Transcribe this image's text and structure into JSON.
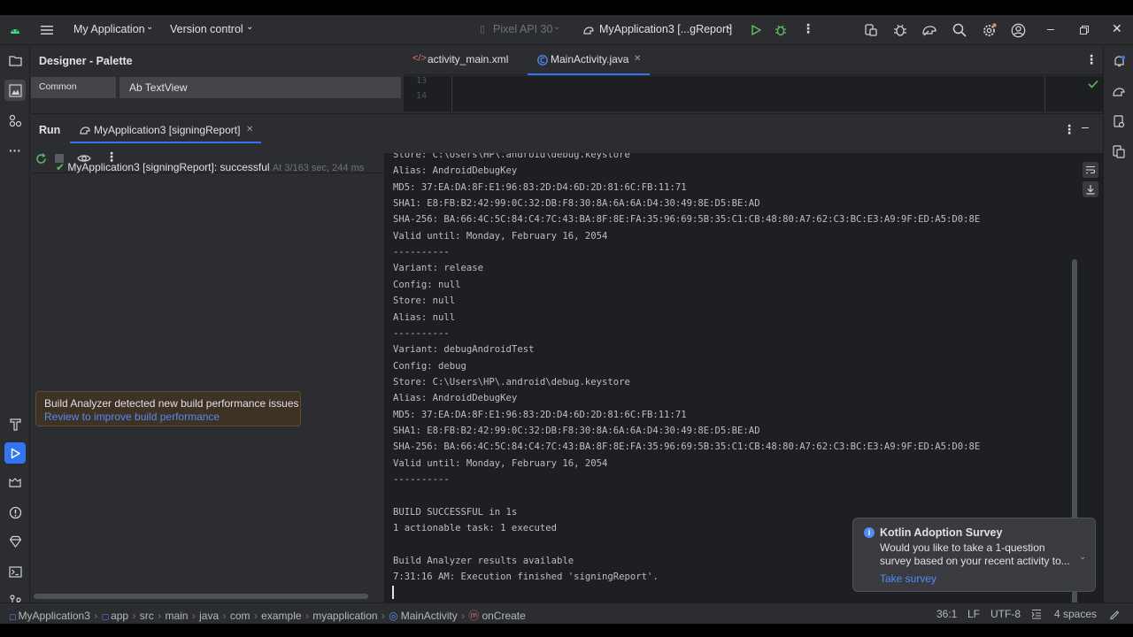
{
  "titlebar": {
    "project": "My Application",
    "vcs": "Version control",
    "device": "Pixel API 30",
    "run_config": "MyApplication3 [...gReport]"
  },
  "designer": {
    "title": "Designer - Palette",
    "category": "Common",
    "item": "Ab TextView"
  },
  "editor": {
    "tabs": [
      {
        "label": "activity_main.xml"
      },
      {
        "label": "MainActivity.java"
      }
    ],
    "line_numbers": [
      "13",
      "14"
    ]
  },
  "run": {
    "title": "Run",
    "tab_label": "MyApplication3 [signingReport]",
    "tree_item": {
      "name": "MyApplication3 [signingReport]:",
      "status": "successful",
      "time": "At 3/16",
      "duration": "3 sec, 244 ms"
    }
  },
  "console": {
    "lines": [
      "Store: C:\\Users\\HP\\.android\\debug.keystore",
      "Alias: AndroidDebugKey",
      "MD5: 37:EA:DA:8F:E1:96:83:2D:D4:6D:2D:81:6C:FB:11:71",
      "SHA1: E8:FB:B2:42:99:0C:32:DB:F8:30:8A:6A:6A:D4:30:49:8E:D5:BE:AD",
      "SHA-256: BA:66:4C:5C:84:C4:7C:43:BA:8F:8E:FA:35:96:69:5B:35:C1:CB:48:80:A7:62:C3:BC:E3:A9:9F:ED:A5:D0:8E",
      "Valid until: Monday, February 16, 2054",
      "----------",
      "Variant: release",
      "Config: null",
      "Store: null",
      "Alias: null",
      "----------",
      "Variant: debugAndroidTest",
      "Config: debug",
      "Store: C:\\Users\\HP\\.android\\debug.keystore",
      "Alias: AndroidDebugKey",
      "MD5: 37:EA:DA:8F:E1:96:83:2D:D4:6D:2D:81:6C:FB:11:71",
      "SHA1: E8:FB:B2:42:99:0C:32:DB:F8:30:8A:6A:6A:D4:30:49:8E:D5:BE:AD",
      "SHA-256: BA:66:4C:5C:84:C4:7C:43:BA:8F:8E:FA:35:96:69:5B:35:C1:CB:48:80:A7:62:C3:BC:E3:A9:9F:ED:A5:D0:8E",
      "Valid until: Monday, February 16, 2054",
      "----------",
      "",
      "BUILD SUCCESSFUL in 1s",
      "1 actionable task: 1 executed",
      "",
      "Build Analyzer results available",
      "7:31:16 AM: Execution finished 'signingReport'."
    ]
  },
  "balloon": {
    "title": "Build Analyzer detected new build performance issues",
    "link": "Review to improve build performance"
  },
  "survey": {
    "title": "Kotlin Adoption Survey",
    "line1": "Would you like to take a 1-question",
    "line2": "survey based on your recent activity to...",
    "action": "Take survey"
  },
  "statusbar": {
    "breadcrumbs": [
      "MyApplication3",
      "app",
      "src",
      "main",
      "java",
      "com",
      "example",
      "myapplication",
      "MainActivity",
      "onCreate"
    ],
    "position": "36:1",
    "line_sep": "LF",
    "encoding": "UTF-8",
    "indent": "4 spaces"
  },
  "colors": {
    "accent": "#3574f0",
    "success": "#5fb865",
    "link": "#548af7"
  }
}
